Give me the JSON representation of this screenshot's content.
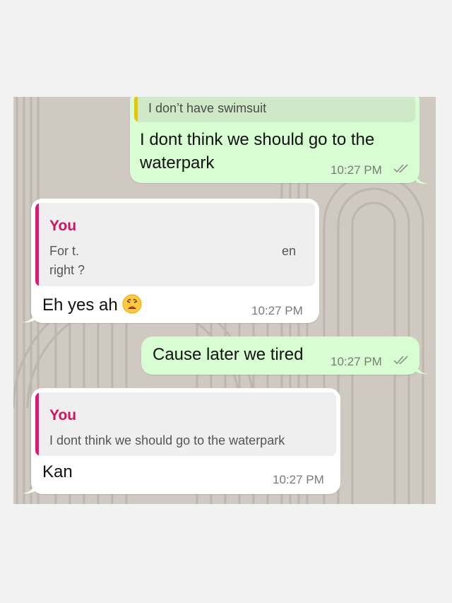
{
  "colors": {
    "outgoing_bubble": "#d9fdd3",
    "incoming_bubble": "#ffffff",
    "quote_bar_self": "#e01576",
    "quote_author_self": "#d1135f",
    "quote_bar_top": "#e6c700",
    "read_ticks": "#8e8e8e",
    "wallpaper": "#cfc9c2"
  },
  "messages": [
    {
      "direction": "outgoing",
      "reply_preview": {
        "text": "I don’t have swimsuit"
      },
      "text": "I dont think we should go to the waterpark",
      "time": "10:27 PM",
      "status": "read-double-check"
    },
    {
      "direction": "incoming",
      "reply_preview": {
        "author": "You",
        "text_line1": "For t.",
        "text_line1_tail": "en",
        "text_line2": "right ?"
      },
      "text": "Eh yes ah",
      "emoji": "weary-face",
      "time": "10:27 PM"
    },
    {
      "direction": "outgoing",
      "text": "Cause later we tired",
      "time": "10:27 PM",
      "status": "read-double-check"
    },
    {
      "direction": "incoming",
      "reply_preview": {
        "author": "You",
        "text": "I dont think we should go to the waterpark"
      },
      "text": "Kan",
      "time": "10:27 PM"
    }
  ]
}
